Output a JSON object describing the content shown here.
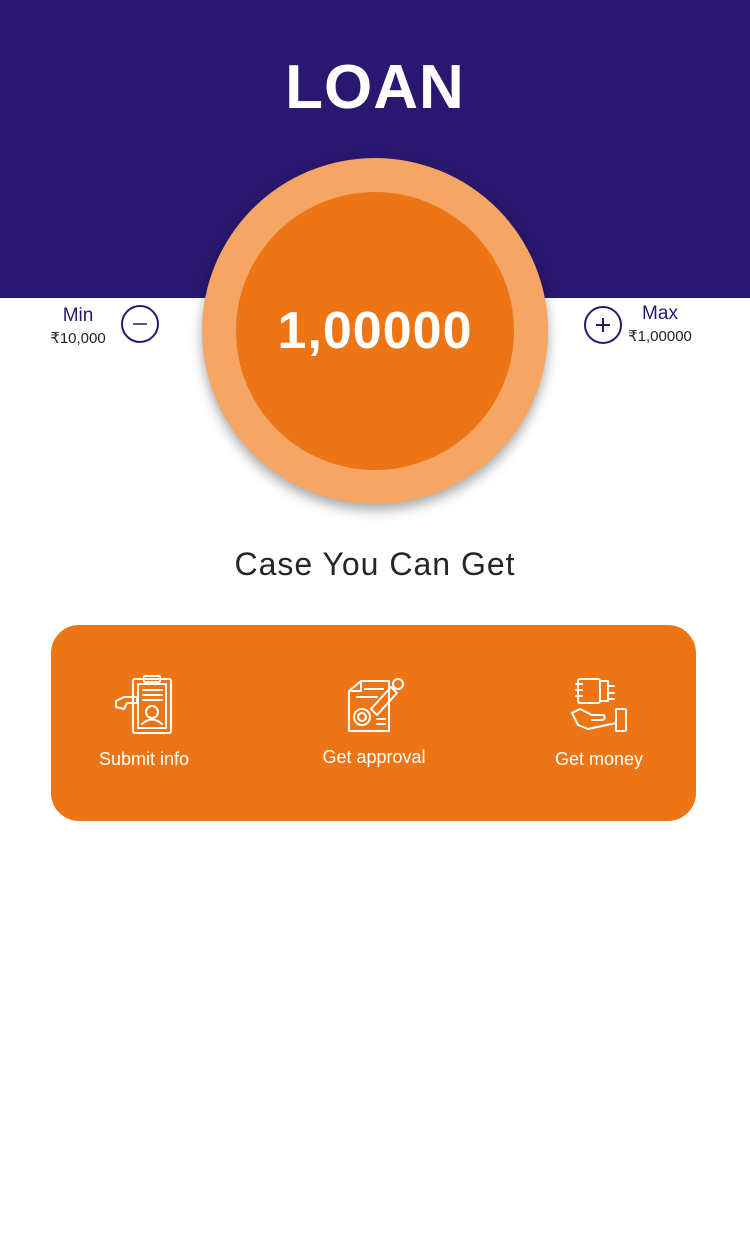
{
  "app": {
    "title": "LOAN"
  },
  "amount": {
    "value": "1,00000"
  },
  "limits": {
    "min_label": "Min",
    "min_value": "₹10,000",
    "max_label": "Max",
    "max_value": "₹1,00000"
  },
  "controls": {
    "decrease_icon": "minus-icon",
    "increase_icon": "plus-icon"
  },
  "section": {
    "subtitle": "Case You Can Get"
  },
  "steps": [
    {
      "label": "Submit info",
      "icon": "clipboard-id-icon"
    },
    {
      "label": "Get approval",
      "icon": "stamp-document-icon"
    },
    {
      "label": "Get money",
      "icon": "hand-money-icon"
    }
  ],
  "colors": {
    "header_bg": "#2a176f",
    "accent_orange": "#ee7516",
    "ring_orange": "#f5a564",
    "text_dark": "#262626"
  }
}
